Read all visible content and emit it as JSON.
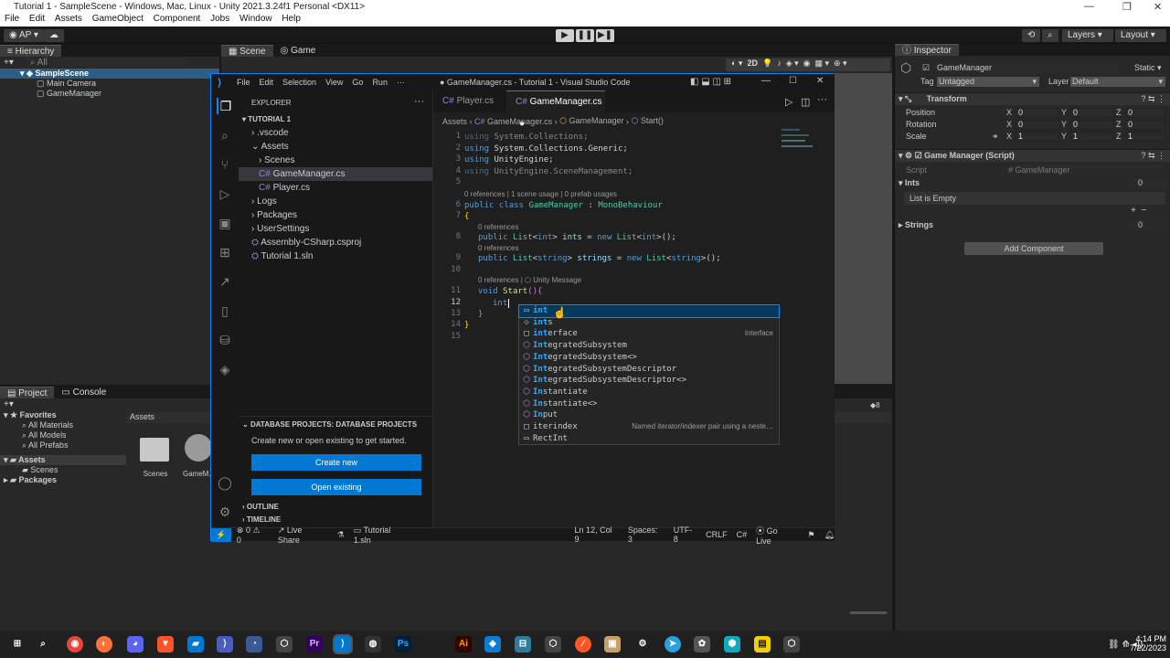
{
  "unity": {
    "title": "Tutorial 1 - SampleScene - Windows, Mac, Linux - Unity 2021.3.24f1 Personal <DX11>",
    "menu": [
      "File",
      "Edit",
      "Assets",
      "GameObject",
      "Component",
      "Jobs",
      "Window",
      "Help"
    ],
    "account": "AP",
    "layers": "Layers",
    "layout": "Layout",
    "hierarchy": {
      "tab": "Hierarchy",
      "search_placeholder": "All",
      "scene": "SampleScene",
      "items": [
        "Main Camera",
        "GameManager"
      ]
    },
    "scene_tabs": [
      "Scene",
      "Game"
    ],
    "project": {
      "tabs": [
        "Project",
        "Console"
      ],
      "favorites": "Favorites",
      "fav_items": [
        "All Materials",
        "All Models",
        "All Prefabs"
      ],
      "assets": "Assets",
      "scenes": "Scenes",
      "packages": "Packages",
      "grid_header": "Assets",
      "grid_items": [
        "Scenes",
        "GameM..."
      ],
      "item_count": "8"
    },
    "inspector": {
      "tab": "Inspector",
      "object_name": "GameManager",
      "static_label": "Static",
      "tag_label": "Tag",
      "tag_value": "Untagged",
      "layer_label": "Layer",
      "layer_value": "Default",
      "transform": "Transform",
      "position": "Position",
      "rotation": "Rotation",
      "scale": "Scale",
      "pos": [
        "0",
        "0",
        "0"
      ],
      "rot": [
        "0",
        "0",
        "0"
      ],
      "scl": [
        "1",
        "1",
        "1"
      ],
      "script_component": "Game Manager (Script)",
      "script_label": "Script",
      "script_value": "GameManager",
      "ints_label": "Ints",
      "ints_count": "0",
      "list_empty": "List is Empty",
      "strings_label": "Strings",
      "strings_count": "0",
      "add_component": "Add Component"
    }
  },
  "vscode": {
    "menu": [
      "File",
      "Edit",
      "Selection",
      "View",
      "Go",
      "Run",
      "···"
    ],
    "title": "● GameManager.cs - Tutorial 1 - Visual Studio Code",
    "explorer": "EXPLORER",
    "workspace": "TUTORIAL 1",
    "tree": [
      ".vscode",
      "Assets",
      "Scenes",
      "GameManager.cs",
      "Player.cs",
      "Logs",
      "Packages",
      "UserSettings",
      "Assembly-CSharp.csproj",
      "Tutorial 1.sln"
    ],
    "db_header": "DATABASE PROJECTS: DATABASE PROJECTS",
    "db_text": "Create new or open existing to get started.",
    "db_create": "Create new",
    "db_open": "Open existing",
    "outline": "OUTLINE",
    "timeline": "TIMELINE",
    "tabs": [
      "Player.cs",
      "GameManager.cs"
    ],
    "breadcrumb": [
      "Assets",
      "GameManager.cs",
      "GameManager",
      "Start()"
    ],
    "codelens1": "0 references | 1 scene usage | 0 prefab usages",
    "codelens_ref": "0 references",
    "codelens_unity": "0 references | ⬡ Unity Message",
    "typed": "int",
    "suggestions": [
      {
        "pre": "int",
        "post": "",
        "icon": "▭",
        "desc": ""
      },
      {
        "pre": "int",
        "post": "s",
        "icon": "◇",
        "desc": ""
      },
      {
        "pre": "int",
        "post": "erface",
        "icon": "□",
        "desc": "Interface"
      },
      {
        "pre": "Int",
        "post": "egratedSubsystem",
        "icon": "⬡",
        "desc": ""
      },
      {
        "pre": "Int",
        "post": "egratedSubsystem<>",
        "icon": "⬡",
        "desc": ""
      },
      {
        "pre": "Int",
        "post": "egratedSubsystemDescriptor",
        "icon": "⬡",
        "desc": ""
      },
      {
        "pre": "Int",
        "post": "egratedSubsystemDescriptor<>",
        "icon": "⬡",
        "desc": ""
      },
      {
        "pre": "In",
        "post": "stantiate",
        "icon": "⬡",
        "desc": ""
      },
      {
        "pre": "In",
        "post": "stantiate<>",
        "icon": "⬡",
        "desc": ""
      },
      {
        "pre": "In",
        "post": "put",
        "icon": "⬡",
        "desc": ""
      },
      {
        "pre": "",
        "post": "iterindex",
        "icon": "□",
        "desc": "Named iterator/indexer pair using a neste…"
      },
      {
        "pre": "",
        "post": "RectInt",
        "icon": "▭",
        "desc": ""
      }
    ],
    "status": {
      "problems": "⊗ 0 ⚠ 0",
      "liveshare": "Live Share",
      "solution": "Tutorial 1.sln",
      "position": "Ln 12, Col 9",
      "spaces": "Spaces: 3",
      "encoding": "UTF-8",
      "eol": "CRLF",
      "lang": "C#",
      "golive": "Go Live"
    }
  },
  "taskbar": {
    "time": "4:14 PM",
    "date": "7/22/2023"
  }
}
